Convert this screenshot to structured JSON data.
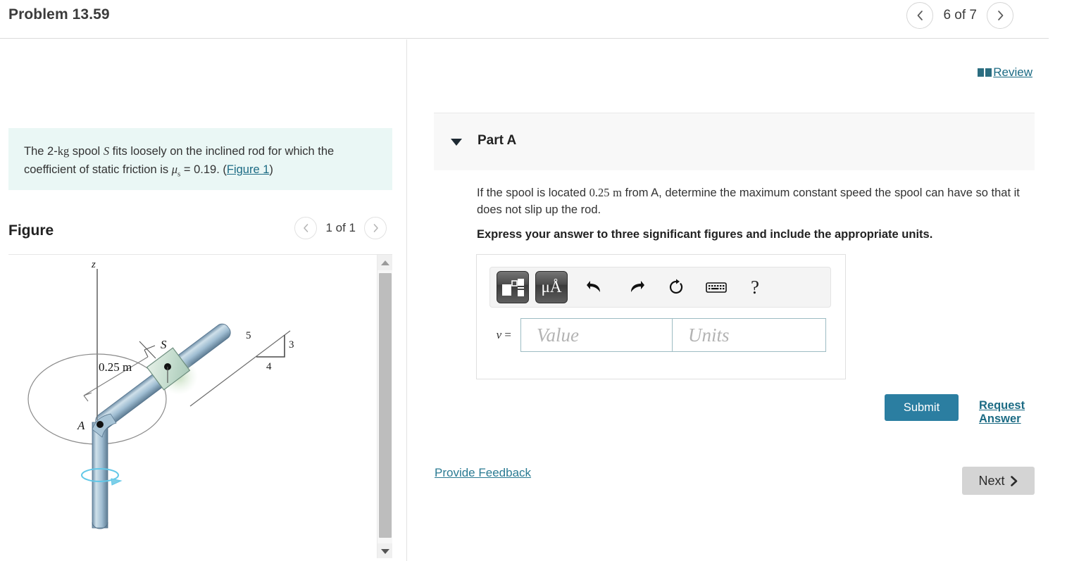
{
  "header": {
    "problem_title": "Problem 13.59",
    "pager_label": "6 of 7",
    "prev_icon": "chevron-left-icon",
    "next_icon": "chevron-right-icon"
  },
  "left_panel": {
    "statement": {
      "part1": "The 2-",
      "unit_kg": "kg",
      "part2": " spool ",
      "var_S": "S",
      "part3": " fits loosely on the inclined rod for which the coefficient of static friction is ",
      "mu_symbol": "μ",
      "mu_subscript": "s",
      "part4": " = 0.19. (",
      "figure_link": "Figure 1",
      "part5": ")"
    },
    "figure": {
      "title": "Figure",
      "pager_label": "1 of 1",
      "labels": {
        "axis_z": "z",
        "point_A": "A",
        "spool_S": "S",
        "distance": "0.25 m",
        "slope_hyp": "5",
        "slope_vert": "3",
        "slope_horiz": "4"
      }
    }
  },
  "right_panel": {
    "review": {
      "label": " Review",
      "icon": "book-icon"
    },
    "part": {
      "title": "Part A",
      "caret_icon": "caret-down-icon"
    },
    "question": "If the spool is located 0.25 m from A, determine the maximum constant speed the spool can have so that it does not slip up the rod.",
    "question_value": "0.25",
    "question_unit": "m",
    "question_pre": "If the spool is located ",
    "question_post": " from A, determine the maximum constant speed the spool can have so that it does not slip up the rod.",
    "instruction": "Express your answer to three significant figures and include the appropriate units.",
    "toolbar": {
      "template_icon": "math-template-icon",
      "units_icon": "micro-angstrom-units-icon",
      "units_label": "μÅ",
      "undo_icon": "undo-arrow-icon",
      "redo_icon": "redo-arrow-icon",
      "reset_icon": "reset-circular-arrow-icon",
      "keyboard_icon": "keyboard-icon",
      "help_icon": "help-question-mark-icon",
      "help_label": "?"
    },
    "answer": {
      "variable_label": "v =",
      "value_placeholder": "Value",
      "units_placeholder": "Units",
      "value": "",
      "units": ""
    },
    "submit_label": "Submit",
    "request_answer_label": "Request Answer",
    "provide_feedback_label": "Provide Feedback",
    "next_label": "Next",
    "next_icon": "chevron-right-bold-icon"
  },
  "colors": {
    "accent_teal": "#2b7ea1",
    "link_teal": "#1c6b84",
    "statement_bg": "#eaf7f5",
    "part_header_bg": "#f8f8f8",
    "next_btn_bg": "#d4d4d4"
  }
}
